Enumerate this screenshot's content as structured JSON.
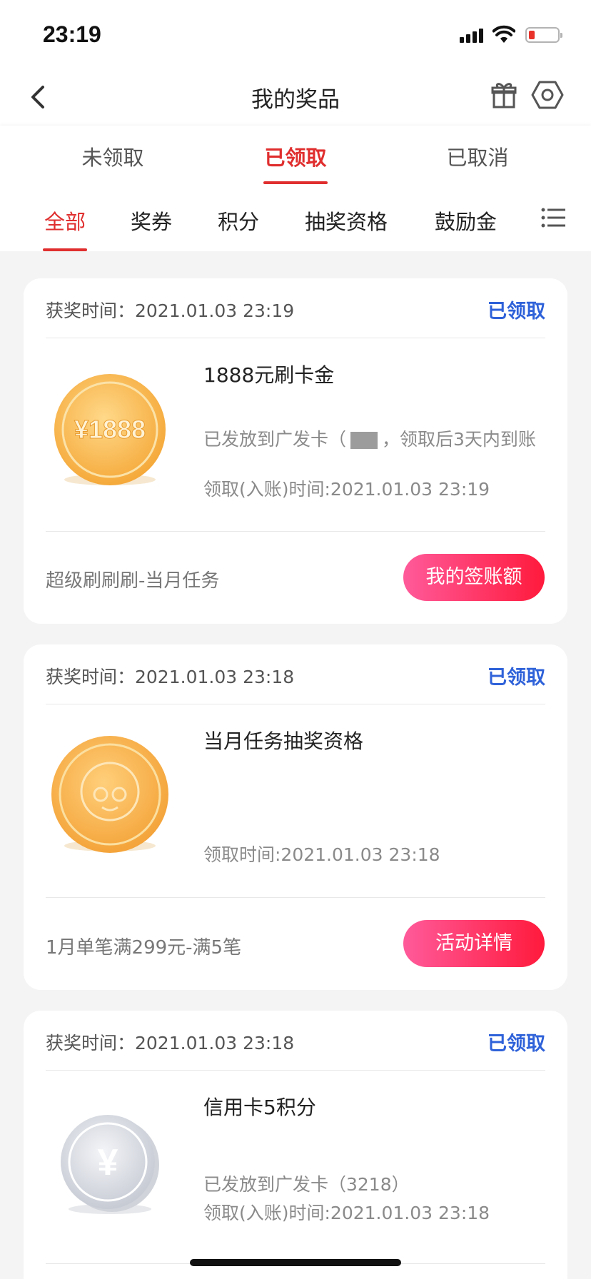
{
  "status_bar": {
    "time": "23:19"
  },
  "header": {
    "title": "我的奖品"
  },
  "main_tabs": [
    {
      "label": "未领取",
      "active": false
    },
    {
      "label": "已领取",
      "active": true
    },
    {
      "label": "已取消",
      "active": false
    }
  ],
  "sub_tabs": [
    {
      "label": "全部",
      "active": true
    },
    {
      "label": "奖券",
      "active": false
    },
    {
      "label": "积分",
      "active": false
    },
    {
      "label": "抽奖资格",
      "active": false
    },
    {
      "label": "鼓励金",
      "active": false
    }
  ],
  "cards": [
    {
      "award_time": "获奖时间：2021.01.03 23:19",
      "status": "已领取",
      "coin_label": "¥1888",
      "prize_name": "1888元刷卡金",
      "detail_pre": "已发放到广发卡（",
      "detail_post": "，领取后3天内到账",
      "claim_time": "领取(入账)时间:2021.01.03 23:19",
      "task": "超级刷刷刷-当月任务",
      "button": "我的签账额"
    },
    {
      "award_time": "获奖时间：2021.01.03 23:18",
      "status": "已领取",
      "prize_name": "当月任务抽奖资格",
      "claim_time": "领取时间:2021.01.03 23:18",
      "task": "1月单笔满299元-满5笔",
      "button": "活动详情"
    },
    {
      "award_time": "获奖时间：2021.01.03 23:18",
      "status": "已领取",
      "coin_label": "¥",
      "prize_name": "信用卡5积分",
      "detail": "已发放到广发卡（3218）",
      "claim_time": "领取(入账)时间:2021.01.03 23:18"
    }
  ],
  "colors": {
    "accent_red": "#e02e2e",
    "status_blue": "#2f62d9",
    "button_gradient_start": "#ff5a9a",
    "button_gradient_end": "#ff1a3c"
  }
}
